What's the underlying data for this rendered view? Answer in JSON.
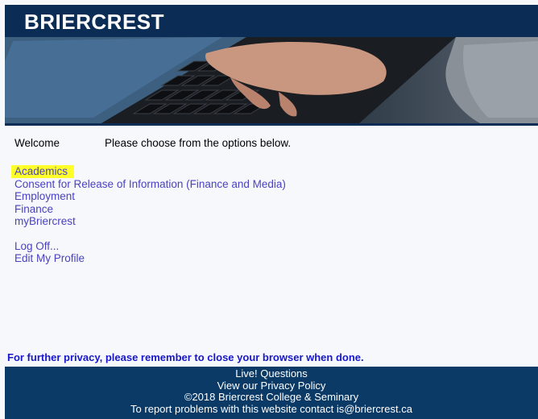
{
  "header": {
    "logo_text": "BRIERCREST"
  },
  "welcome": {
    "label": "Welcome",
    "message": "Please choose from the options below."
  },
  "menu": {
    "items": [
      {
        "label": "Academics"
      },
      {
        "label": "Consent for Release of Information (Finance and Media)"
      },
      {
        "label": "Employment"
      },
      {
        "label": "Finance"
      },
      {
        "label": "myBriercrest"
      }
    ],
    "account": [
      {
        "label": "Log Off..."
      },
      {
        "label": "Edit My Profile"
      }
    ]
  },
  "privacy_notice": "For further privacy, please remember to close your browser when done.",
  "footer": {
    "live_questions": "Live! Questions",
    "privacy_policy": "View our Privacy Policy",
    "copyright": "©2018 Briercrest College & Seminary",
    "contact": "To report problems with this website contact is@briercrest.ca"
  },
  "colors": {
    "header_bg": "#0b2d55",
    "footer_bg": "#0b3a66",
    "link": "#4a42c0",
    "highlight": "#ffff2a",
    "privacy_text": "#1818c8"
  }
}
